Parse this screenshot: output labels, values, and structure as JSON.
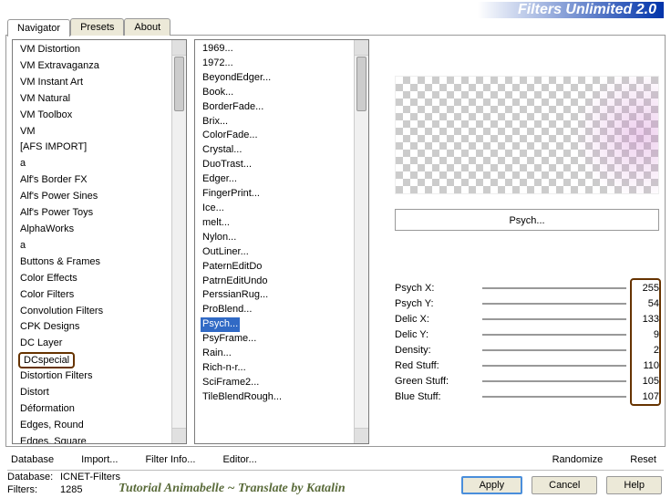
{
  "header": {
    "title": "Filters Unlimited 2.0"
  },
  "tabs": {
    "items": [
      "Navigator",
      "Presets",
      "About"
    ],
    "active": 0
  },
  "categories": [
    "VM Distortion",
    "VM Extravaganza",
    "VM Instant Art",
    "VM Natural",
    "VM Toolbox",
    "VM",
    "[AFS IMPORT]",
    "a",
    "Alf's Border FX",
    "Alf's Power Sines",
    "Alf's Power Toys",
    "AlphaWorks",
    "a",
    "Buttons & Frames",
    "Color Effects",
    "Color Filters",
    "Convolution Filters",
    "CPK Designs",
    "DC Layer",
    "DCspecial",
    "Distortion Filters",
    "Distort",
    "Déformation",
    "Edges, Round",
    "Edges, Square"
  ],
  "categories_highlight_index": 19,
  "filters": [
    "1969...",
    "1972...",
    "BeyondEdger...",
    "Book...",
    "BorderFade...",
    "Brix...",
    "ColorFade...",
    "Crystal...",
    "DuoTrast...",
    "Edger...",
    "FingerPrint...",
    "Ice...",
    "melt...",
    "Nylon...",
    "OutLiner...",
    "PaternEditDo",
    "PatrnEditUndo",
    "PerssianRug...",
    "ProBlend...",
    "Psych...",
    "PsyFrame...",
    "Rain...",
    "Rich-n-r...",
    "SciFrame2...",
    "TileBlendRough..."
  ],
  "filters_selected_index": 19,
  "preview": {
    "label": "Psych..."
  },
  "params": [
    {
      "label": "Psych X:",
      "value": 255
    },
    {
      "label": "Psych Y:",
      "value": 54
    },
    {
      "label": "Delic X:",
      "value": 133
    },
    {
      "label": "Delic Y:",
      "value": 9
    },
    {
      "label": "Density:",
      "value": 2
    },
    {
      "label": "Red Stuff:",
      "value": 110
    },
    {
      "label": "Green Stuff:",
      "value": 105
    },
    {
      "label": "Blue Stuff:",
      "value": 107
    }
  ],
  "bottom_left": {
    "database": "Database",
    "import": "Import...",
    "filter_info": "Filter Info...",
    "editor": "Editor..."
  },
  "bottom_right": {
    "randomize": "Randomize",
    "reset": "Reset"
  },
  "status": {
    "db_label": "Database:",
    "db_value": "ICNET-Filters",
    "filters_label": "Filters:",
    "filters_value": "1285"
  },
  "tutorial": "Tutorial Animabelle ~ Translate by Katalin",
  "buttons": {
    "apply": "Apply",
    "cancel": "Cancel",
    "help": "Help"
  }
}
